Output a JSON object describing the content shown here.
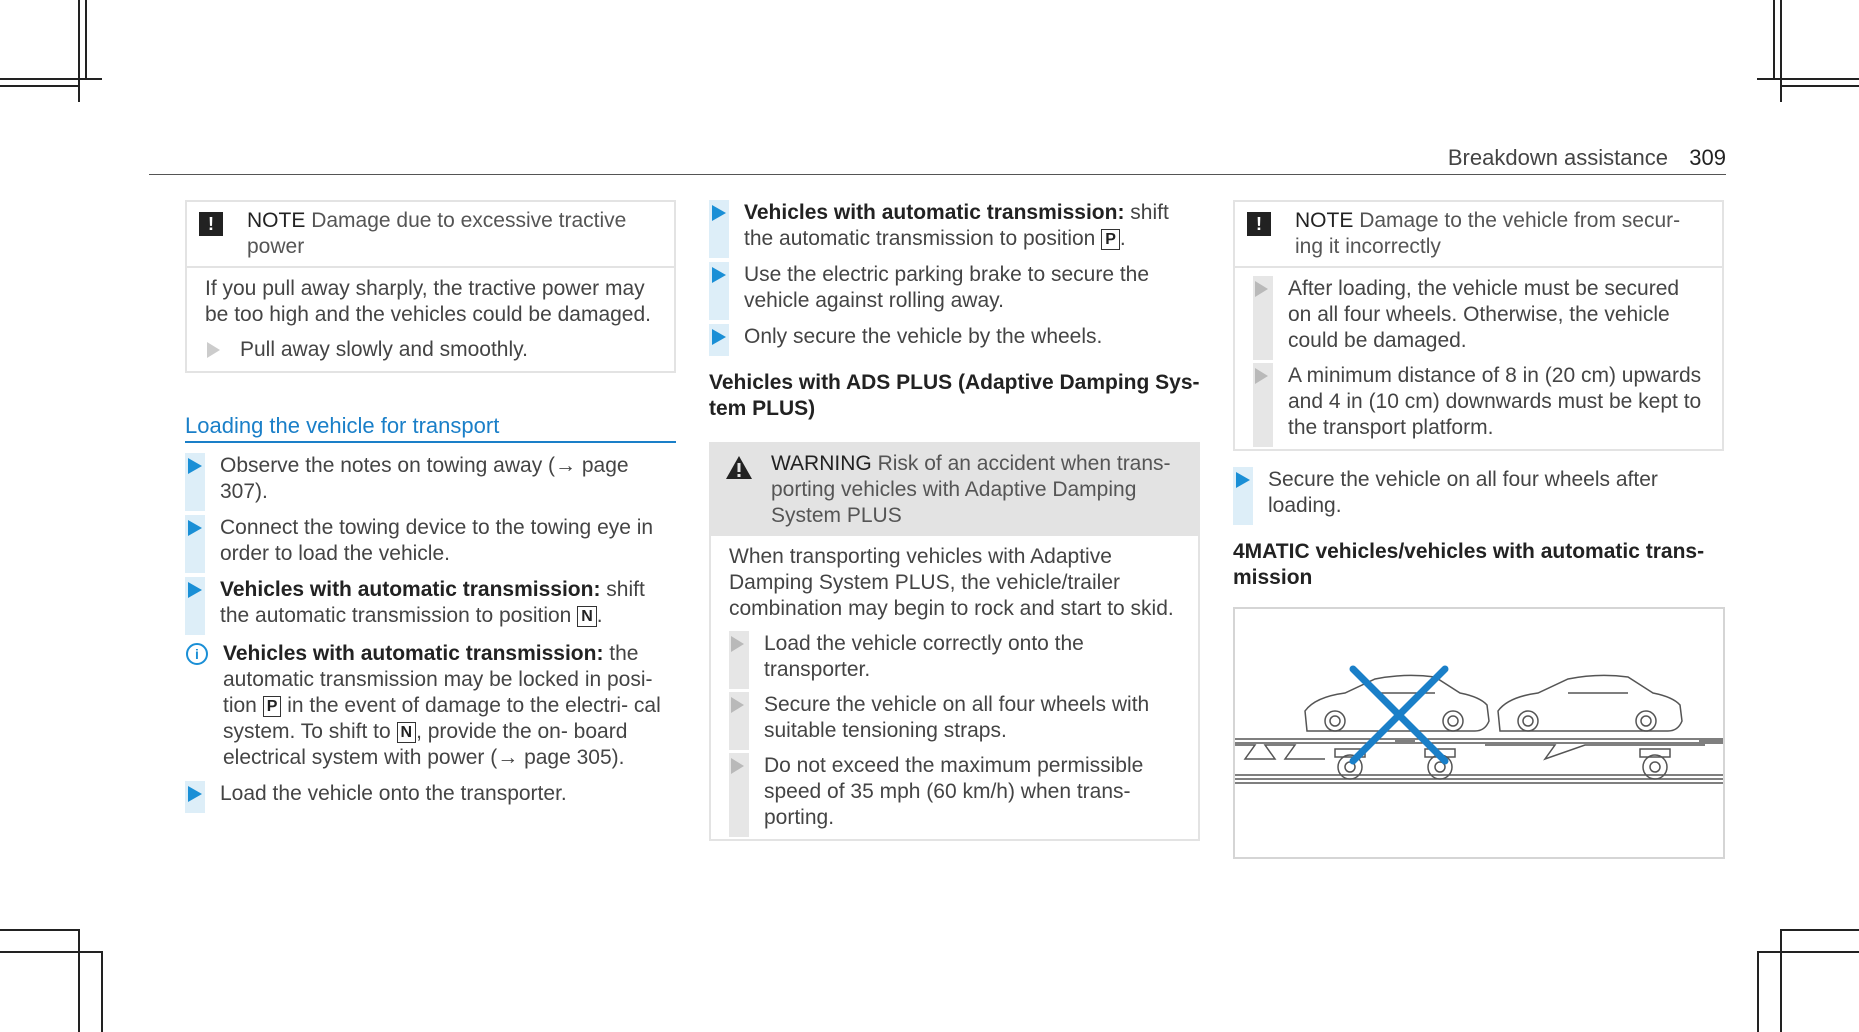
{
  "header": {
    "section": "Breakdown assistance",
    "page": "309"
  },
  "col1": {
    "note": {
      "label": "NOTE",
      "title": "Damage due to excessive tractive power",
      "text": "If you pull away sharply, the tractive power may be too high and the vehicles could be damaged.",
      "step": "Pull away slowly and smoothly."
    },
    "section_title": "Loading the vehicle for transport",
    "steps": [
      "Observe the notes on towing away (→ page 307).",
      "Connect the towing device to the towing eye in order to load the vehicle."
    ],
    "step3_bold": "Vehicles with automatic transmission:",
    "step3_rest": "shift the automatic transmission to position",
    "step3_key": "N",
    "info_bold": "Vehicles with automatic transmission:",
    "info_a": "the automatic transmission may be locked in posi- tion",
    "info_key1": "P",
    "info_b": "in the event of damage to the electri- cal system. To shift to",
    "info_key2": "N",
    "info_c": ", provide the on- board electrical system with power (→ page 305).",
    "last_step": "Load the vehicle onto the transporter."
  },
  "col2": {
    "step1_bold": "Vehicles with automatic transmission:",
    "step1_rest": "shift the automatic transmission to position",
    "step1_key": "P",
    "steps": [
      "Use the electric parking brake to secure the vehicle against rolling away.",
      "Only secure the vehicle by the wheels."
    ],
    "subhead": "Vehicles with ADS PLUS (Adaptive Damping Sys- tem PLUS)",
    "warning": {
      "label": "WARNING",
      "title": "Risk of an accident when trans- porting vehicles with Adaptive Damping System PLUS",
      "text": "When transporting vehicles with Adaptive Damping System PLUS, the vehicle/trailer combination may begin to rock and start to skid.",
      "steps": [
        "Load the vehicle correctly onto the transporter.",
        "Secure the vehicle on all four wheels with suitable tensioning straps.",
        "Do not exceed the maximum permissible speed of 35 mph (60 km/h) when trans- porting."
      ]
    }
  },
  "col3": {
    "note": {
      "label": "NOTE",
      "title": "Damage to the vehicle from secur- ing it incorrectly",
      "steps": [
        "After loading, the vehicle must be secured on all four wheels. Otherwise, the vehicle could be damaged.",
        "A minimum distance of 8 in (20 cm) upwards and 4 in (10 cm) downwards must be kept to the transport platform."
      ]
    },
    "step": "Secure the vehicle on all four wheels after loading.",
    "subhead": "4MATIC vehicles/vehicles with automatic trans- mission"
  },
  "colors": {
    "accent": "#1a8fd6",
    "step_bar": "#ddeef8",
    "box_border": "#e3e3e3"
  },
  "icons": [
    "note-icon",
    "warning-icon",
    "info-icon",
    "step-arrow-icon",
    "cross-mark-icon"
  ]
}
